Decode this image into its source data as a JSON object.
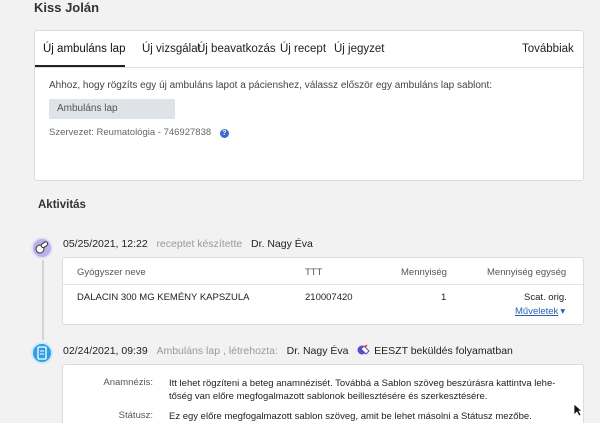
{
  "patient": {
    "name": "Kiss Jolán"
  },
  "tabs": [
    {
      "label": "Új ambuláns lap",
      "active": true
    },
    {
      "label": "Új vizsgálat"
    },
    {
      "label": "Új beavatkozás"
    },
    {
      "label": "Új recept"
    },
    {
      "label": "Új jegyzet"
    }
  ],
  "more_label": "Továbbiak",
  "form": {
    "instructions": "Ahhoz, hogy rögzíts egy új ambuláns lapot a pácienshez, válassz először egy ambuláns lap sablont:",
    "template_placeholder": "Ambuláns lap",
    "org_text": "Szervezet: Reumatológia - 746927838",
    "help_glyph": "?"
  },
  "activity": {
    "title": "Aktivitás",
    "entries": [
      {
        "icon": "pills-icon",
        "datetime": "05/25/2021, 12:22",
        "action": "receptet készítette",
        "doctor": "Dr. Nagy Éva",
        "table": {
          "headers": [
            "Gyógyszer neve",
            "TTT",
            "Mennyiség",
            "Mennyiség egység"
          ],
          "rows": [
            [
              "DALACIN 300 MG KEMÉNY KAPSZULA",
              "210007420",
              "1",
              "Scat. orig."
            ]
          ]
        },
        "actions_label": "Műveletek"
      },
      {
        "icon": "document-icon",
        "datetime": "02/24/2021, 09:39",
        "action": "Ambuláns lap , létrehozta:",
        "doctor": "Dr. Nagy Éva",
        "status": "EESZT beküldés folyamatban",
        "fields": [
          {
            "label": "Anamnézis:",
            "text": "Itt lehet rögzíteni a beteg anamnézisét. Továbbá a Sablon szöveg beszúrásra kattintva lehe-tőség van előre megfogalmazott sablonok beillesztésére és szerkesztésére."
          },
          {
            "label": "Státusz:",
            "text": "Ez egy előre megfogalmazott sablon szöveg, amit  be lehet másolni  a Státusz mezőbe."
          }
        ]
      }
    ]
  },
  "colors": {
    "accent": "#2b5fb3",
    "timeline_purple": "#b9b1ea",
    "timeline_blue": "#2d9fe6"
  }
}
